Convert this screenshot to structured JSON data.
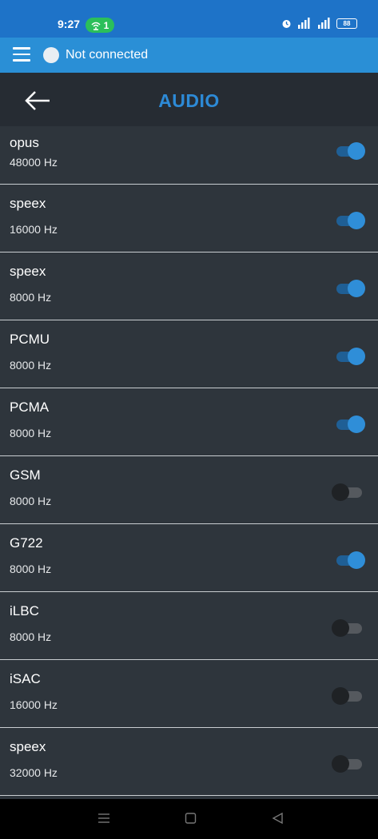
{
  "status_bar": {
    "time": "9:27",
    "hotspot_count": "1",
    "battery": "88"
  },
  "app_bar": {
    "connection_status": "Not connected"
  },
  "header": {
    "title": "AUDIO"
  },
  "codecs": [
    {
      "name": "opus",
      "rate": "48000 Hz",
      "enabled": true
    },
    {
      "name": "speex",
      "rate": "16000 Hz",
      "enabled": true
    },
    {
      "name": "speex",
      "rate": "8000 Hz",
      "enabled": true
    },
    {
      "name": "PCMU",
      "rate": "8000 Hz",
      "enabled": true
    },
    {
      "name": "PCMA",
      "rate": "8000 Hz",
      "enabled": true
    },
    {
      "name": "GSM",
      "rate": "8000 Hz",
      "enabled": false
    },
    {
      "name": "G722",
      "rate": "8000 Hz",
      "enabled": true
    },
    {
      "name": "iLBC",
      "rate": "8000 Hz",
      "enabled": false
    },
    {
      "name": "iSAC",
      "rate": "16000 Hz",
      "enabled": false
    },
    {
      "name": "speex",
      "rate": "32000 Hz",
      "enabled": false
    }
  ],
  "colors": {
    "accent": "#2a8fd6",
    "status_bar": "#1e73c8",
    "background": "#2e353c",
    "title_bar": "#262c33"
  }
}
